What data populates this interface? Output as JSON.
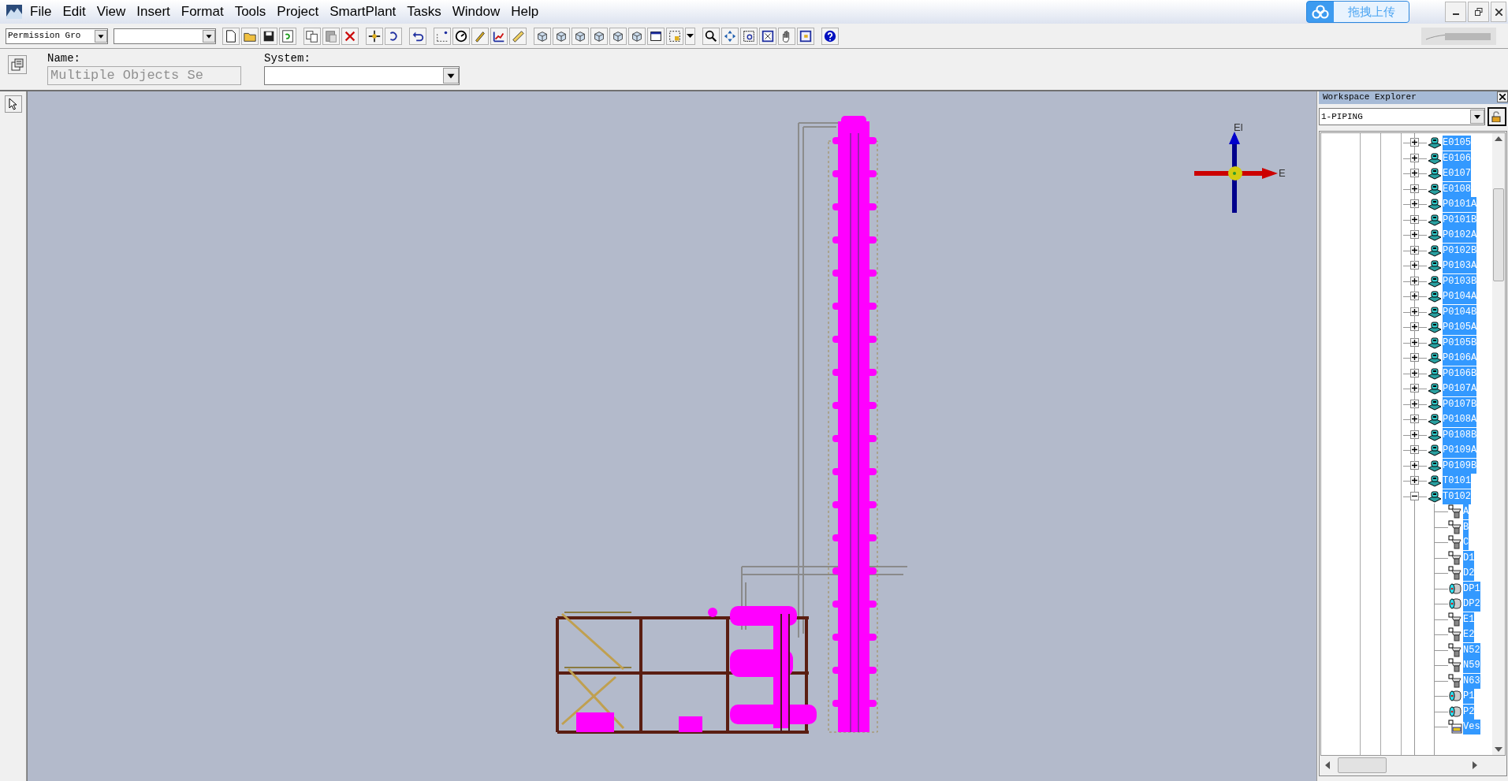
{
  "menu": [
    {
      "label": "File"
    },
    {
      "label": "Edit"
    },
    {
      "label": "View"
    },
    {
      "label": "Insert"
    },
    {
      "label": "Format"
    },
    {
      "label": "Tools"
    },
    {
      "label": "Project"
    },
    {
      "label": "SmartPlant"
    },
    {
      "label": "Tasks"
    },
    {
      "label": "Window"
    },
    {
      "label": "Help"
    }
  ],
  "upload_button": "拖拽上传",
  "toolbar": {
    "permission_group": "Permission Gro"
  },
  "properties": {
    "name_label": "Name:",
    "name_value": "Multiple Objects Se",
    "name_disabled": true,
    "system_label": "System:"
  },
  "compass": {
    "up_label": "El",
    "east_label": "E"
  },
  "explorer": {
    "title": "Workspace Explorer",
    "filter": "1-PIPING",
    "tree": [
      {
        "label": "E0105",
        "kind": "equipment",
        "selected": true,
        "expanded": false
      },
      {
        "label": "E0106",
        "kind": "equipment",
        "selected": true,
        "expanded": false
      },
      {
        "label": "E0107",
        "kind": "equipment",
        "selected": true,
        "expanded": false
      },
      {
        "label": "E0108",
        "kind": "equipment",
        "selected": true,
        "expanded": false
      },
      {
        "label": "P0101A",
        "kind": "equipment",
        "selected": true,
        "expanded": false
      },
      {
        "label": "P0101B",
        "kind": "equipment",
        "selected": true,
        "expanded": false
      },
      {
        "label": "P0102A",
        "kind": "equipment",
        "selected": true,
        "expanded": false
      },
      {
        "label": "P0102B",
        "kind": "equipment",
        "selected": true,
        "expanded": false
      },
      {
        "label": "P0103A",
        "kind": "equipment",
        "selected": true,
        "expanded": false
      },
      {
        "label": "P0103B",
        "kind": "equipment",
        "selected": true,
        "expanded": false
      },
      {
        "label": "P0104A",
        "kind": "equipment",
        "selected": true,
        "expanded": false
      },
      {
        "label": "P0104B",
        "kind": "equipment",
        "selected": true,
        "expanded": false
      },
      {
        "label": "P0105A",
        "kind": "equipment",
        "selected": true,
        "expanded": false
      },
      {
        "label": "P0105B",
        "kind": "equipment",
        "selected": true,
        "expanded": false
      },
      {
        "label": "P0106A",
        "kind": "equipment",
        "selected": true,
        "expanded": false
      },
      {
        "label": "P0106B",
        "kind": "equipment",
        "selected": true,
        "expanded": false
      },
      {
        "label": "P0107A",
        "kind": "equipment",
        "selected": true,
        "expanded": false
      },
      {
        "label": "P0107B",
        "kind": "equipment",
        "selected": true,
        "expanded": false
      },
      {
        "label": "P0108A",
        "kind": "equipment",
        "selected": true,
        "expanded": false
      },
      {
        "label": "P0108B",
        "kind": "equipment",
        "selected": true,
        "expanded": false
      },
      {
        "label": "P0109A",
        "kind": "equipment",
        "selected": true,
        "expanded": false
      },
      {
        "label": "P0109B",
        "kind": "equipment",
        "selected": true,
        "expanded": false
      },
      {
        "label": "T0101",
        "kind": "equipment",
        "selected": true,
        "expanded": false
      },
      {
        "label": "T0102",
        "kind": "equipment",
        "selected": true,
        "expanded": true,
        "children": [
          {
            "label": "A",
            "kind": "nozzle",
            "selected": true
          },
          {
            "label": "B",
            "kind": "nozzle",
            "selected": true
          },
          {
            "label": "C",
            "kind": "nozzle",
            "selected": true
          },
          {
            "label": "D1",
            "kind": "nozzle",
            "selected": true
          },
          {
            "label": "D2",
            "kind": "nozzle",
            "selected": true
          },
          {
            "label": "DP1",
            "kind": "cylinder",
            "selected": true
          },
          {
            "label": "DP2",
            "kind": "cylinder",
            "selected": true
          },
          {
            "label": "E1",
            "kind": "nozzle",
            "selected": true
          },
          {
            "label": "E2",
            "kind": "nozzle",
            "selected": true
          },
          {
            "label": "N52",
            "kind": "nozzle",
            "selected": true
          },
          {
            "label": "N59",
            "kind": "nozzle",
            "selected": true
          },
          {
            "label": "N63",
            "kind": "nozzle",
            "selected": true
          },
          {
            "label": "P1",
            "kind": "cylinder",
            "selected": true
          },
          {
            "label": "P2",
            "kind": "cylinder",
            "selected": true
          },
          {
            "label": "Ves",
            "kind": "vessel",
            "selected": true
          }
        ]
      }
    ]
  }
}
